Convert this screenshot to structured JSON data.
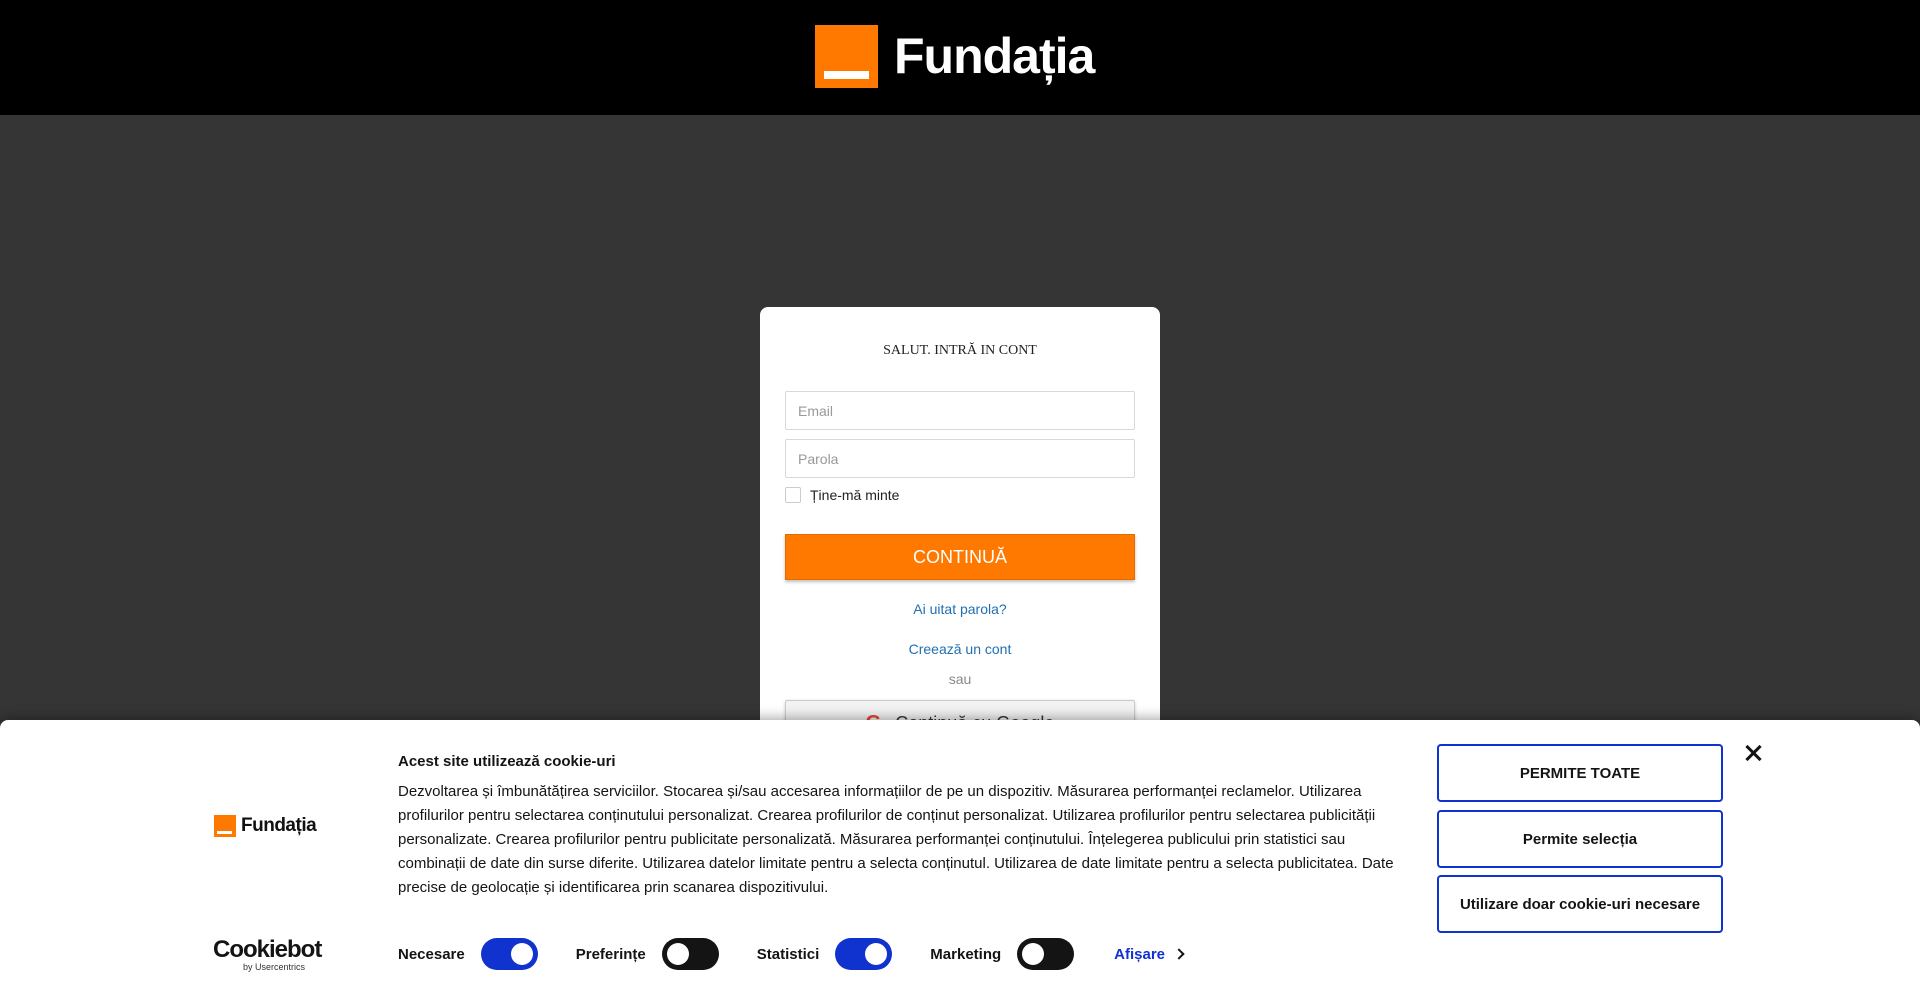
{
  "header": {
    "brand": "Fundația"
  },
  "login": {
    "title": "SALUT. INTRĂ IN CONT",
    "email_placeholder": "Email",
    "password_placeholder": "Parola",
    "remember_label": "Ține-mă minte",
    "continue_label": "CONTINUĂ",
    "forgot_link": "Ai uitat parola?",
    "create_link": "Creează un cont",
    "or_text": "sau",
    "google_label": "Continuă cu Google"
  },
  "cookie_banner": {
    "logo_text": "Fundația",
    "title": "Acest site utilizează cookie-uri",
    "body": "Dezvoltarea și îmbunătățirea serviciilor. Stocarea și/sau accesarea informațiilor de pe un dispozitiv. Măsurarea performanței reclamelor. Utilizarea profilurilor pentru selectarea conținutului personalizat. Crearea profilurilor de conținut personalizat. Utilizarea profilurilor pentru selectarea publicității personalizate. Crearea profilurilor pentru publicitate personalizată. Măsurarea performanței conținutului. Înțelegerea publicului prin statistici sau combinații de date din surse diferite. Utilizarea datelor limitate pentru a selecta conținutul. Utilizarea de date limitate pentru a selecta publicitatea. Date precise de geolocație și identificarea prin scanarea dispozitivului.",
    "toggles": [
      {
        "label": "Necesare",
        "on": true
      },
      {
        "label": "Preferințe",
        "on": false
      },
      {
        "label": "Statistici",
        "on": true
      },
      {
        "label": "Marketing",
        "on": false
      }
    ],
    "details_label": "Afișare",
    "buttons": {
      "allow_all": "PERMITE TOATE",
      "allow_selection": "Permite selecția",
      "necessary_only": "Utilizare doar cookie-uri necesare"
    },
    "powered_by": {
      "name": "Cookiebot",
      "by": "by Usercentrics"
    },
    "accent_color": "#1032cf"
  },
  "colors": {
    "brand_orange": "#ff7900",
    "overlay": "#353535"
  }
}
